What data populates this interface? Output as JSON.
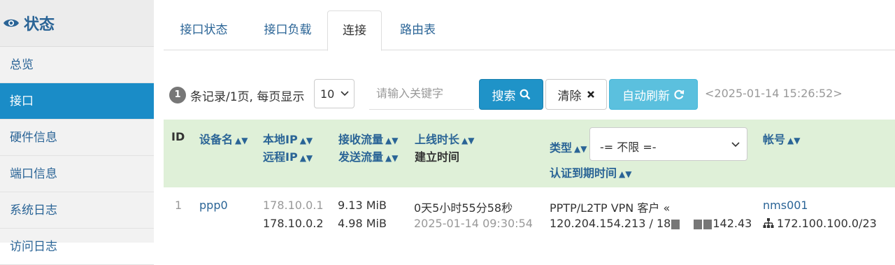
{
  "sidebar": {
    "title": "状态",
    "items": [
      {
        "label": "总览"
      },
      {
        "label": "接口"
      },
      {
        "label": "硬件信息"
      },
      {
        "label": "端口信息"
      },
      {
        "label": "系统日志"
      },
      {
        "label": "访问日志"
      }
    ],
    "active_index": 1
  },
  "tabs": [
    "接口状态",
    "接口负载",
    "连接",
    "路由表"
  ],
  "active_tab": "连接",
  "toolbar": {
    "count": "1",
    "records_text": "条记录/1页, 每页显示",
    "page_size": "10",
    "search_placeholder": "请输入关键字",
    "search_label": "搜索",
    "clear_label": "清除",
    "refresh_label": "自动刷新",
    "timestamp": "<2025-01-14 15:26:52>"
  },
  "table": {
    "headers": {
      "id": "ID",
      "device": "设备名",
      "local_ip": "本地IP",
      "remote_ip": "远程IP",
      "rx": "接收流量",
      "tx": "发送流量",
      "uptime": "上线时长",
      "created": "建立时间",
      "type": "类型",
      "type_filter": "-= 不限 =-",
      "auth_expire": "认证到期时间",
      "account": "帐号"
    },
    "rows": [
      {
        "id": "1",
        "device": "ppp0",
        "local_ip": "178.10.0.1",
        "remote_ip": "178.10.0.2",
        "rx": "9.13 MiB",
        "tx": "4.98 MiB",
        "uptime": "0天5小时55分58秒",
        "created": "2025-01-14 09:30:54",
        "type": "PPTP/L2TP VPN 客户 «",
        "peer_prefix": "120.204.154.213 / 18",
        "peer_suffix": "142.43",
        "account": "nms001",
        "subnet": "172.100.100.0/23"
      }
    ]
  },
  "colors": {
    "accent": "#1a8cc7",
    "link": "#2a6496",
    "header_bg": "#dff0d8"
  }
}
